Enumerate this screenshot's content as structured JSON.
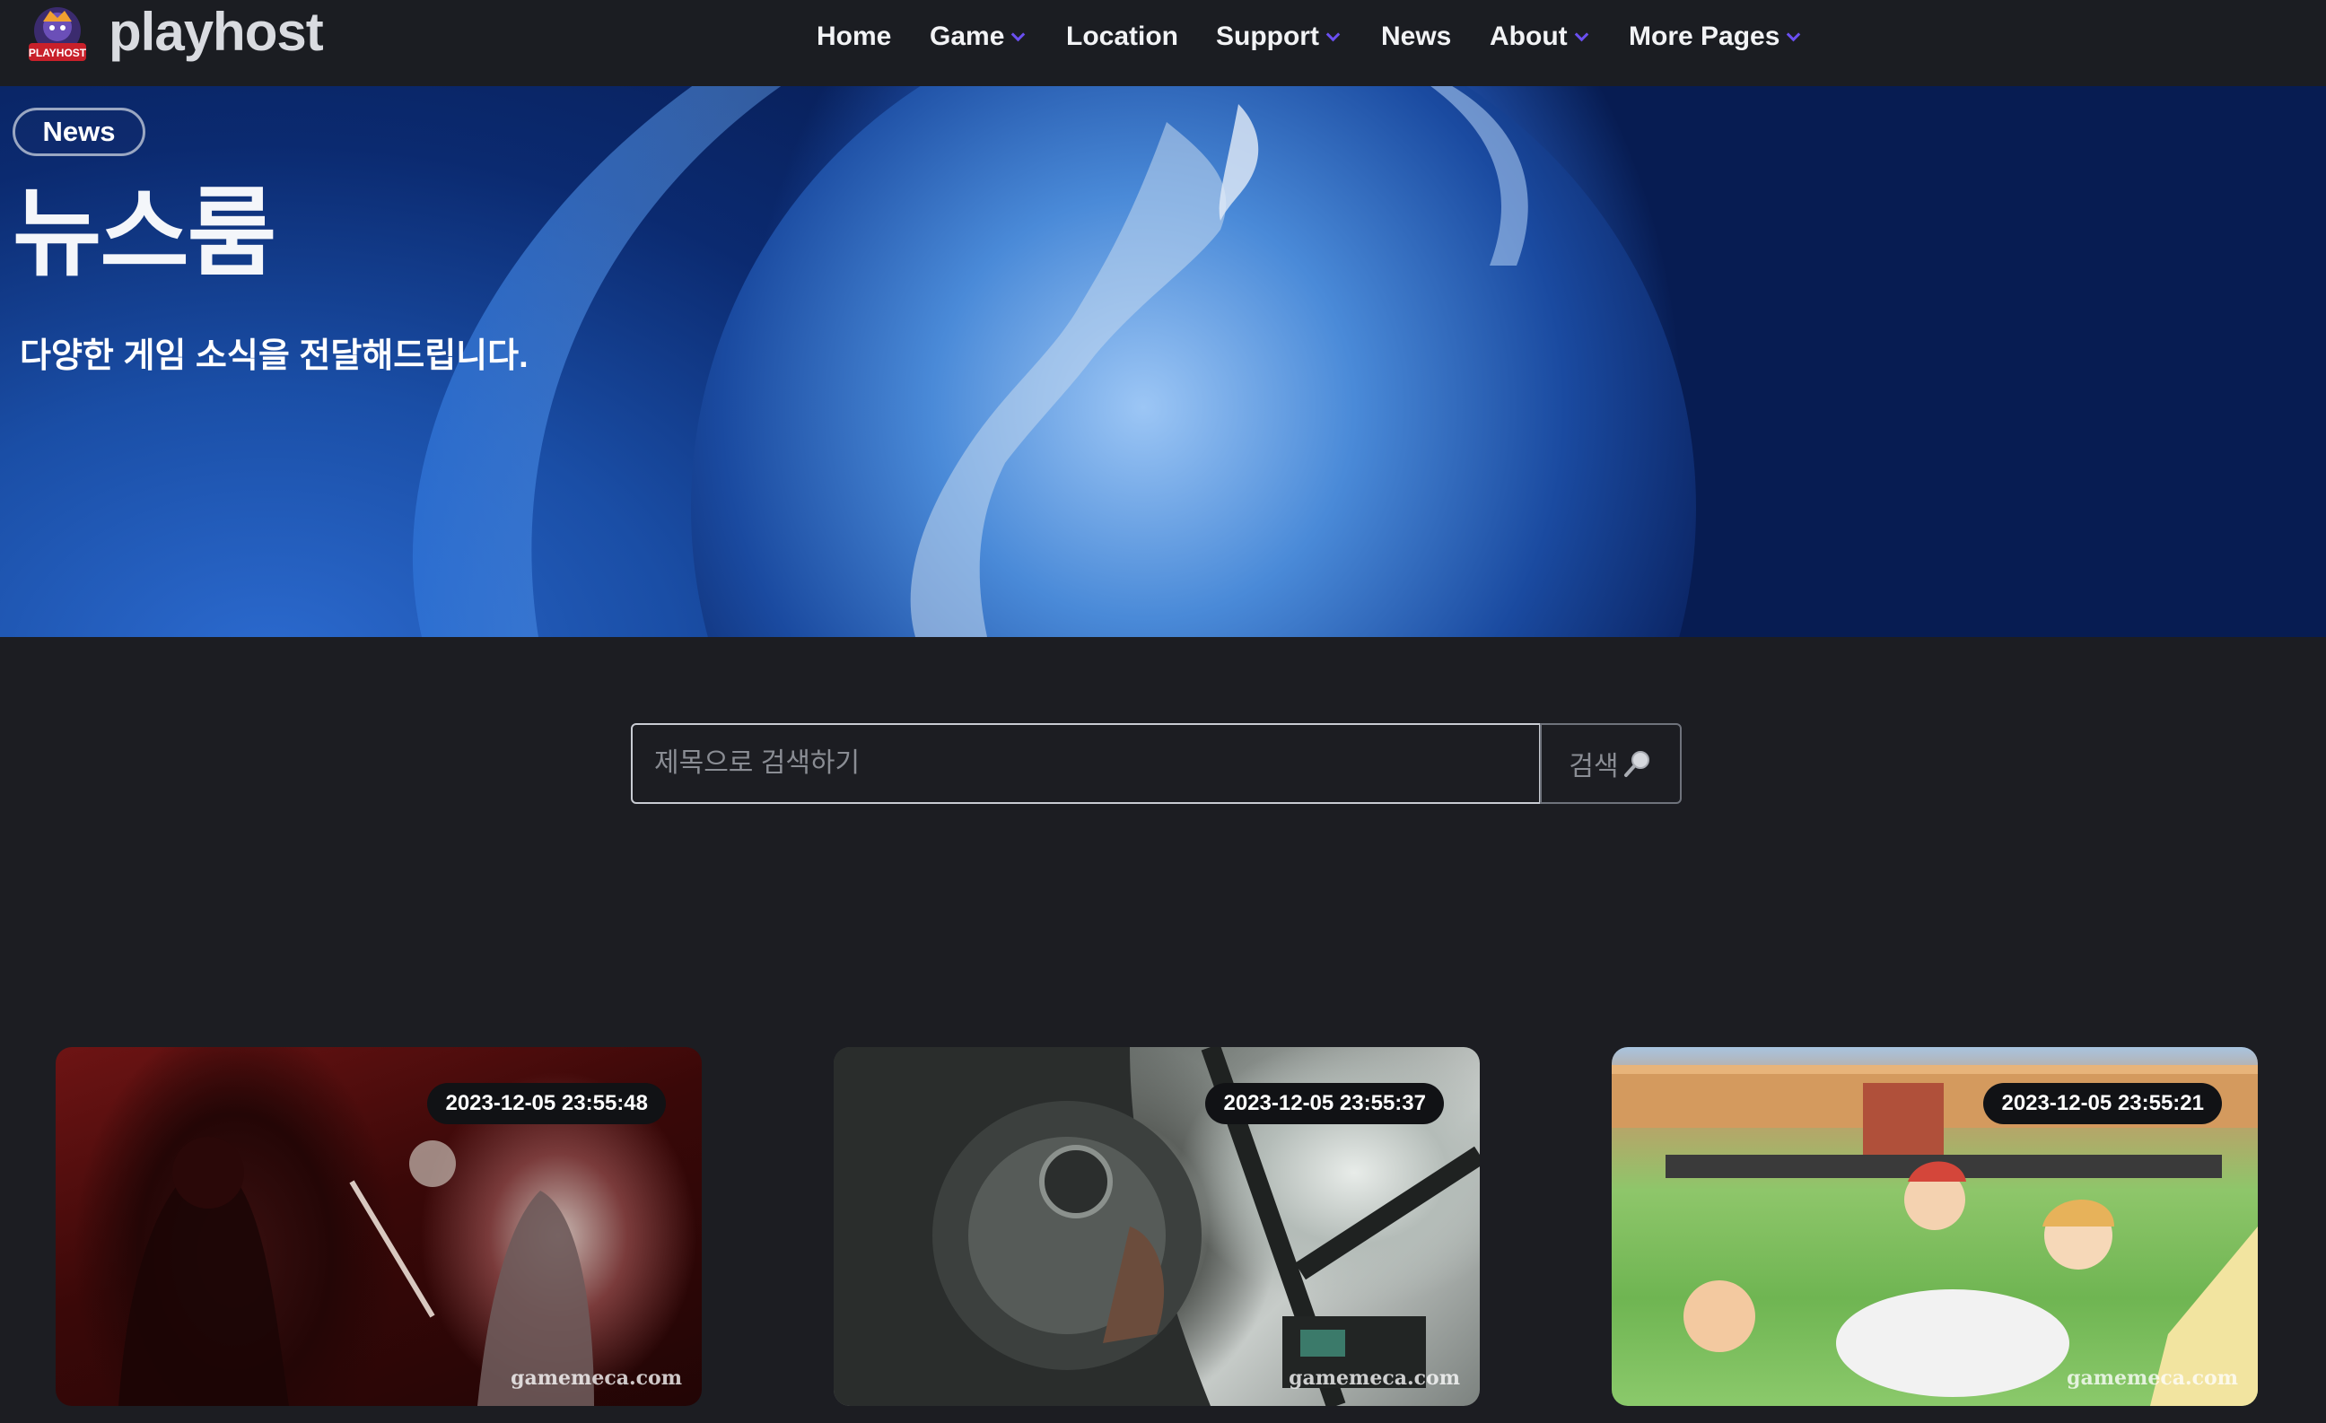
{
  "header": {
    "logo_badge_text": "PLAYHOST",
    "logo_text": "playhost",
    "nav": [
      {
        "label": "Home",
        "has_dropdown": false
      },
      {
        "label": "Game",
        "has_dropdown": true
      },
      {
        "label": "Location",
        "has_dropdown": false
      },
      {
        "label": "Support",
        "has_dropdown": true
      },
      {
        "label": "News",
        "has_dropdown": false
      },
      {
        "label": "About",
        "has_dropdown": true
      },
      {
        "label": "More Pages",
        "has_dropdown": true
      }
    ],
    "caret_color": "#6a4ff0"
  },
  "hero": {
    "badge": "News",
    "title": "뉴스룸",
    "subtitle": "다양한 게임 소식을 전달해드립니다."
  },
  "search": {
    "placeholder": "제목으로 검색하기",
    "value": "",
    "button_label": "검색",
    "button_icon": "magnifier-icon"
  },
  "cards": [
    {
      "date": "2023-12-05 23:55:48",
      "watermark": "gamemeca.com"
    },
    {
      "date": "2023-12-05 23:55:37",
      "watermark": "gamemeca.com"
    },
    {
      "date": "2023-12-05 23:55:21",
      "watermark": "gamemeca.com"
    }
  ],
  "colors": {
    "page_background": "#1c1d22",
    "header_background": "#1b1d22",
    "accent": "#6a4ff0",
    "hero_blue": "#1554b8"
  }
}
